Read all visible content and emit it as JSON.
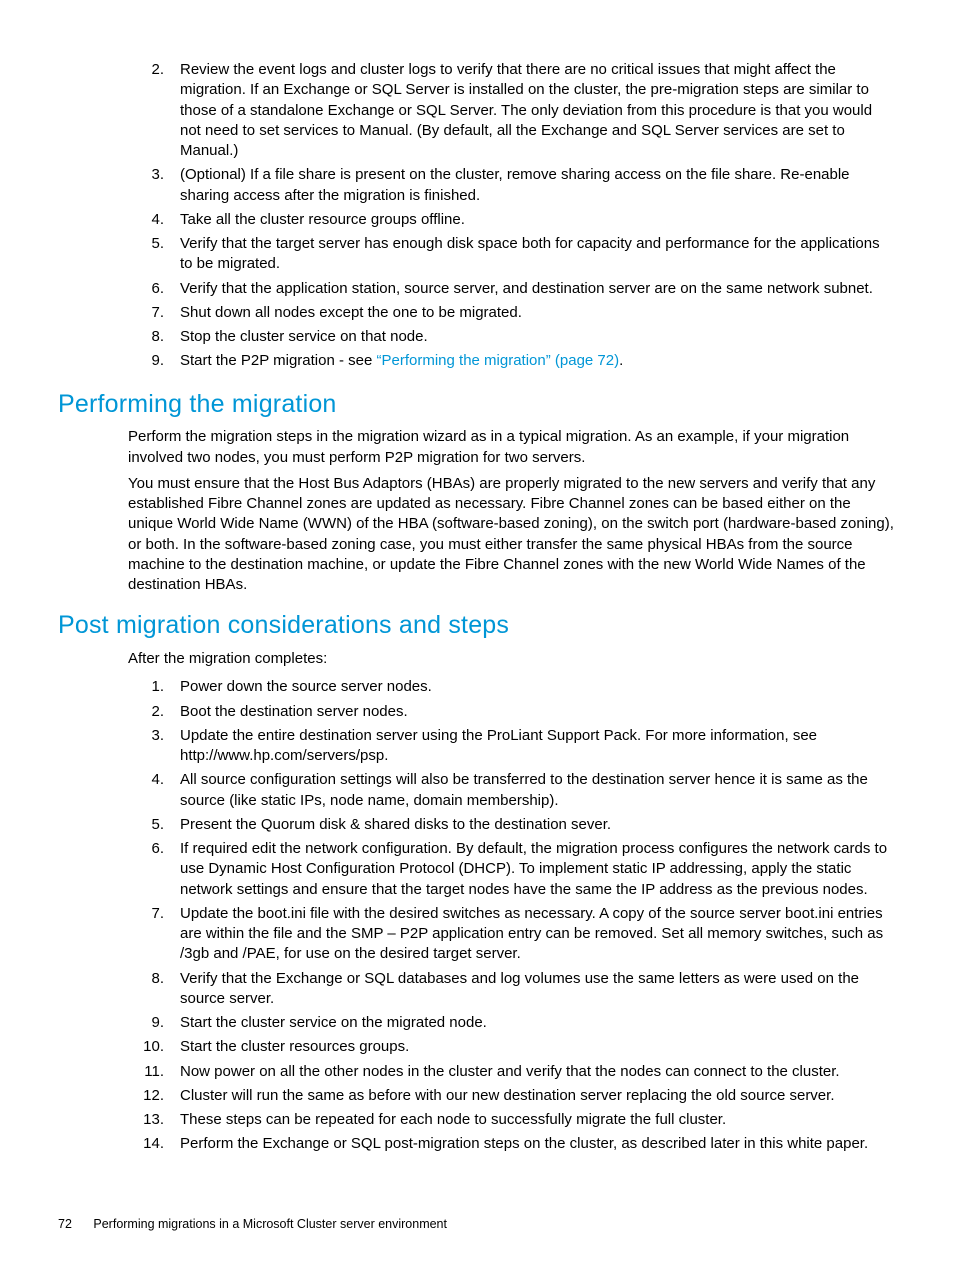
{
  "list1": {
    "start": 2,
    "items": [
      "Review the event logs and cluster logs to verify that there are no critical issues that might affect the migration. If an Exchange or SQL Server is installed on the cluster, the pre-migration steps are similar to those of a standalone Exchange or SQL Server. The only deviation from this procedure is that you would not need to set services to Manual. (By default, all the Exchange and SQL Server services are set to Manual.)",
      "(Optional) If a file share is present on the cluster, remove sharing access on the file share. Re-enable sharing access after the migration is finished.",
      "Take all the cluster resource groups offline.",
      "Verify that the target server has enough disk space both for capacity and performance for the applications to be migrated.",
      "Verify that the application station, source server, and destination server are on the same network subnet.",
      "Shut down all nodes except the one to be migrated.",
      "Stop the cluster service on that node."
    ],
    "lastPrefix": "Start the P2P migration - see ",
    "lastLinkText": "“Performing the migration” (page 72)",
    "lastSuffix": "."
  },
  "section1": {
    "heading": "Performing the migration",
    "p1": "Perform the migration steps in the migration wizard as in a typical migration. As an example, if your migration involved two nodes, you must perform P2P migration for two servers.",
    "p2": "You must ensure that the Host Bus Adaptors (HBAs) are properly migrated to the new servers and verify that any established Fibre Channel zones are updated as necessary. Fibre Channel zones can be based either on the unique World Wide Name (WWN) of the HBA (software-based zoning), on the switch port (hardware-based zoning), or both. In the software-based zoning case, you must either transfer the same physical HBAs from the source machine to the destination machine, or update the Fibre Channel zones with the new World Wide Names of the destination HBAs."
  },
  "section2": {
    "heading": "Post migration considerations and steps",
    "intro": "After the migration completes:",
    "items": [
      "Power down the source server nodes.",
      "Boot the destination server nodes.",
      "Update the entire destination server using the ProLiant Support Pack. For more information, see http://www.hp.com/servers/psp.",
      "All source configuration settings will also be transferred to the destination server hence it is same as the source (like static IPs, node name, domain membership).",
      "Present the Quorum disk & shared disks to the destination sever.",
      "If required edit the network configuration. By default, the migration process configures the network cards to use Dynamic Host Configuration Protocol (DHCP). To implement static IP addressing, apply the static network settings and ensure that the target nodes have the same the IP address as the previous nodes.",
      "Update the boot.ini file with the desired switches as necessary. A copy of the source server boot.ini entries are within the file and the SMP – P2P application entry can be removed. Set all memory switches, such as /3gb and /PAE, for use on the desired target server.",
      "Verify that the Exchange or SQL databases and log volumes use the same letters as were used on the source server.",
      "Start the cluster service on the migrated node.",
      "Start the cluster resources groups.",
      "Now power on all the other nodes in the cluster and verify that the nodes can connect to the cluster.",
      "Cluster will run the same as before with our new destination server replacing the old source server.",
      "These steps can be repeated for each node to successfully migrate the full cluster.",
      "Perform the Exchange or SQL post-migration steps on the cluster, as described later in this white paper."
    ]
  },
  "footer": {
    "page": "72",
    "title": "Performing migrations in a Microsoft Cluster server environment"
  }
}
